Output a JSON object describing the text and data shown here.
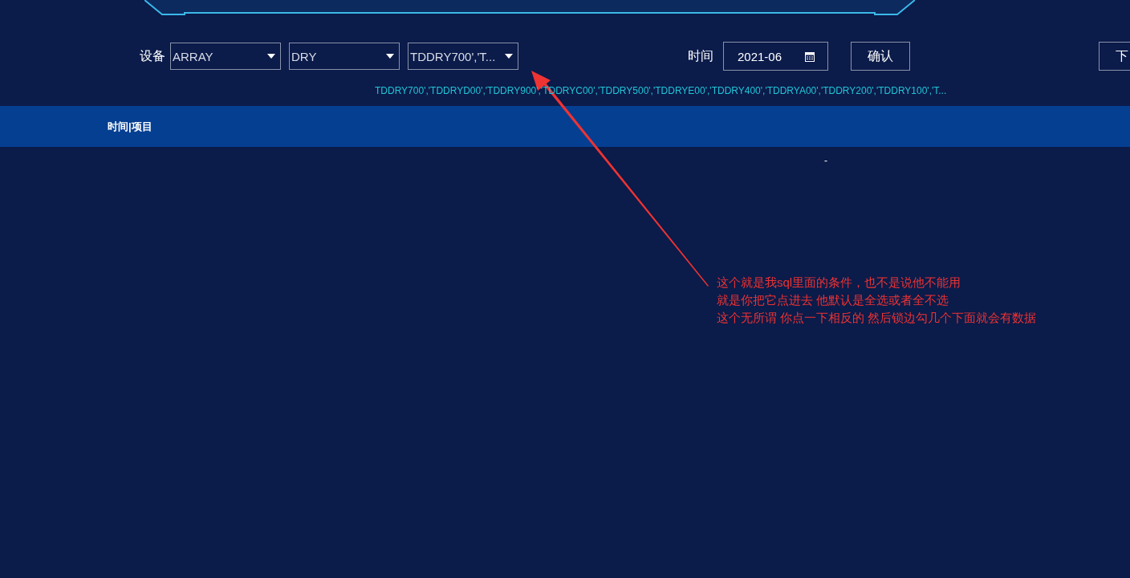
{
  "filters": {
    "device_label": "设备",
    "selects": [
      {
        "value": "ARRAY"
      },
      {
        "value": "DRY"
      },
      {
        "value": "TDDRY700','T..."
      }
    ],
    "time_label": "时间",
    "date_value": "2021-06",
    "buttons": [
      "确认",
      "下"
    ]
  },
  "selected_summary": "TDDRY700','TDDRYD00','TDDRY900','TDDRYC00','TDDRY500','TDDRYE00','TDDRY400','TDDRYA00','TDDRY200','TDDRY100','T...",
  "table": {
    "columns": [
      "时间|项目"
    ],
    "rows": [
      [
        "-"
      ]
    ]
  },
  "annotation": {
    "lines": [
      "这个就是我sql里面的条件，也不是说他不能用",
      "就是你把它点进去 他默认是全选或者全不选",
      "这个无所谓  你点一下相反的 然后锁边勾几个下面就会有数据"
    ]
  }
}
